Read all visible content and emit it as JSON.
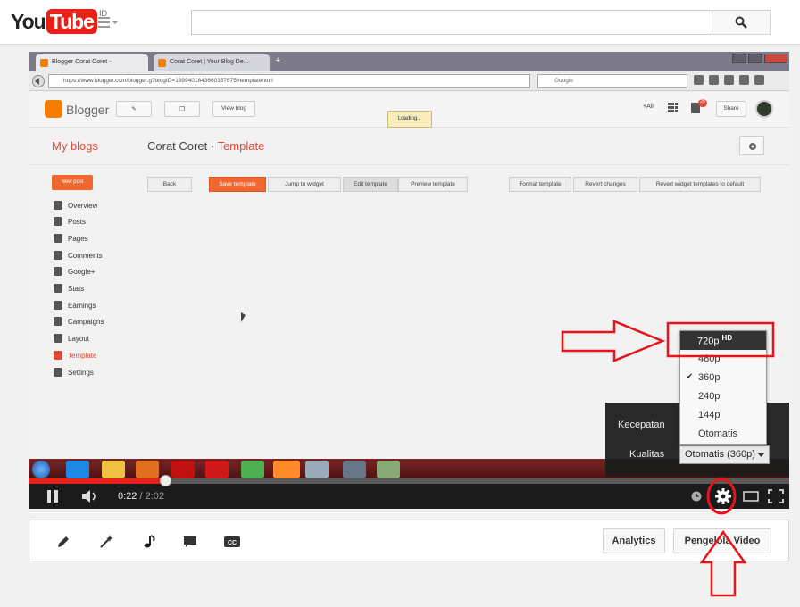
{
  "header": {
    "logo_you": "You",
    "logo_tube": "Tube",
    "region": "ID",
    "guide_icon": "menu-icon",
    "search_placeholder": "",
    "search_icon": "search-icon"
  },
  "browser": {
    "tabs": [
      {
        "label": "Blogger Corat Coret -"
      },
      {
        "label": "Corat Coret | Your Blog De..."
      }
    ],
    "url": "https://www.blogger.com/blogger.g?blogID=1999401843660357875#templatehtml",
    "search_placeholder": "Google"
  },
  "blogger": {
    "brand": "Blogger",
    "view_blog": "View blog",
    "loading": "Loading...",
    "all_label": "+Ali",
    "share": "Share",
    "notif_count": "29",
    "my_blogs": "My blogs",
    "blog_name": "Corat Coret",
    "separator": "·",
    "current_page": "Template",
    "new_post": "New post",
    "sidebar": [
      {
        "label": "Overview",
        "active": false
      },
      {
        "label": "Posts",
        "active": false
      },
      {
        "label": "Pages",
        "active": false
      },
      {
        "label": "Comments",
        "active": false
      },
      {
        "label": "Google+",
        "active": false
      },
      {
        "label": "Stats",
        "active": false
      },
      {
        "label": "Earnings",
        "active": false
      },
      {
        "label": "Campaigns",
        "active": false
      },
      {
        "label": "Layout",
        "active": false
      },
      {
        "label": "Template",
        "active": true
      },
      {
        "label": "Settings",
        "active": false
      }
    ],
    "toolbar": {
      "back": "Back",
      "save": "Save template",
      "jump": "Jump to widget",
      "edit": "Edit template",
      "preview": "Preview template",
      "format": "Format template",
      "revert": "Revert changes",
      "revert_widgets": "Revert widget templates to default"
    }
  },
  "player": {
    "current_time": "0:22",
    "time_separator": " / ",
    "duration": "2:02",
    "progress": 0.18,
    "speed_label": "Kecepatan",
    "quality_label": "Kualitas",
    "quality_value": "Otomatis (360p)",
    "quality_options": [
      {
        "label": "720p",
        "badge": "HD",
        "highlight": true,
        "checked": false
      },
      {
        "label": "480p",
        "checked": false
      },
      {
        "label": "360p",
        "checked": true
      },
      {
        "label": "240p",
        "checked": false
      },
      {
        "label": "144p",
        "checked": false
      },
      {
        "label": "Otomatis",
        "checked": false
      }
    ],
    "check_mark": "✔"
  },
  "actions": {
    "analytics": "Analytics",
    "video_manager": "Pengelola Video"
  },
  "colors": {
    "youtube_red": "#e62117",
    "blogger_orange": "#f57d00",
    "annotation_red": "#e8141b"
  }
}
